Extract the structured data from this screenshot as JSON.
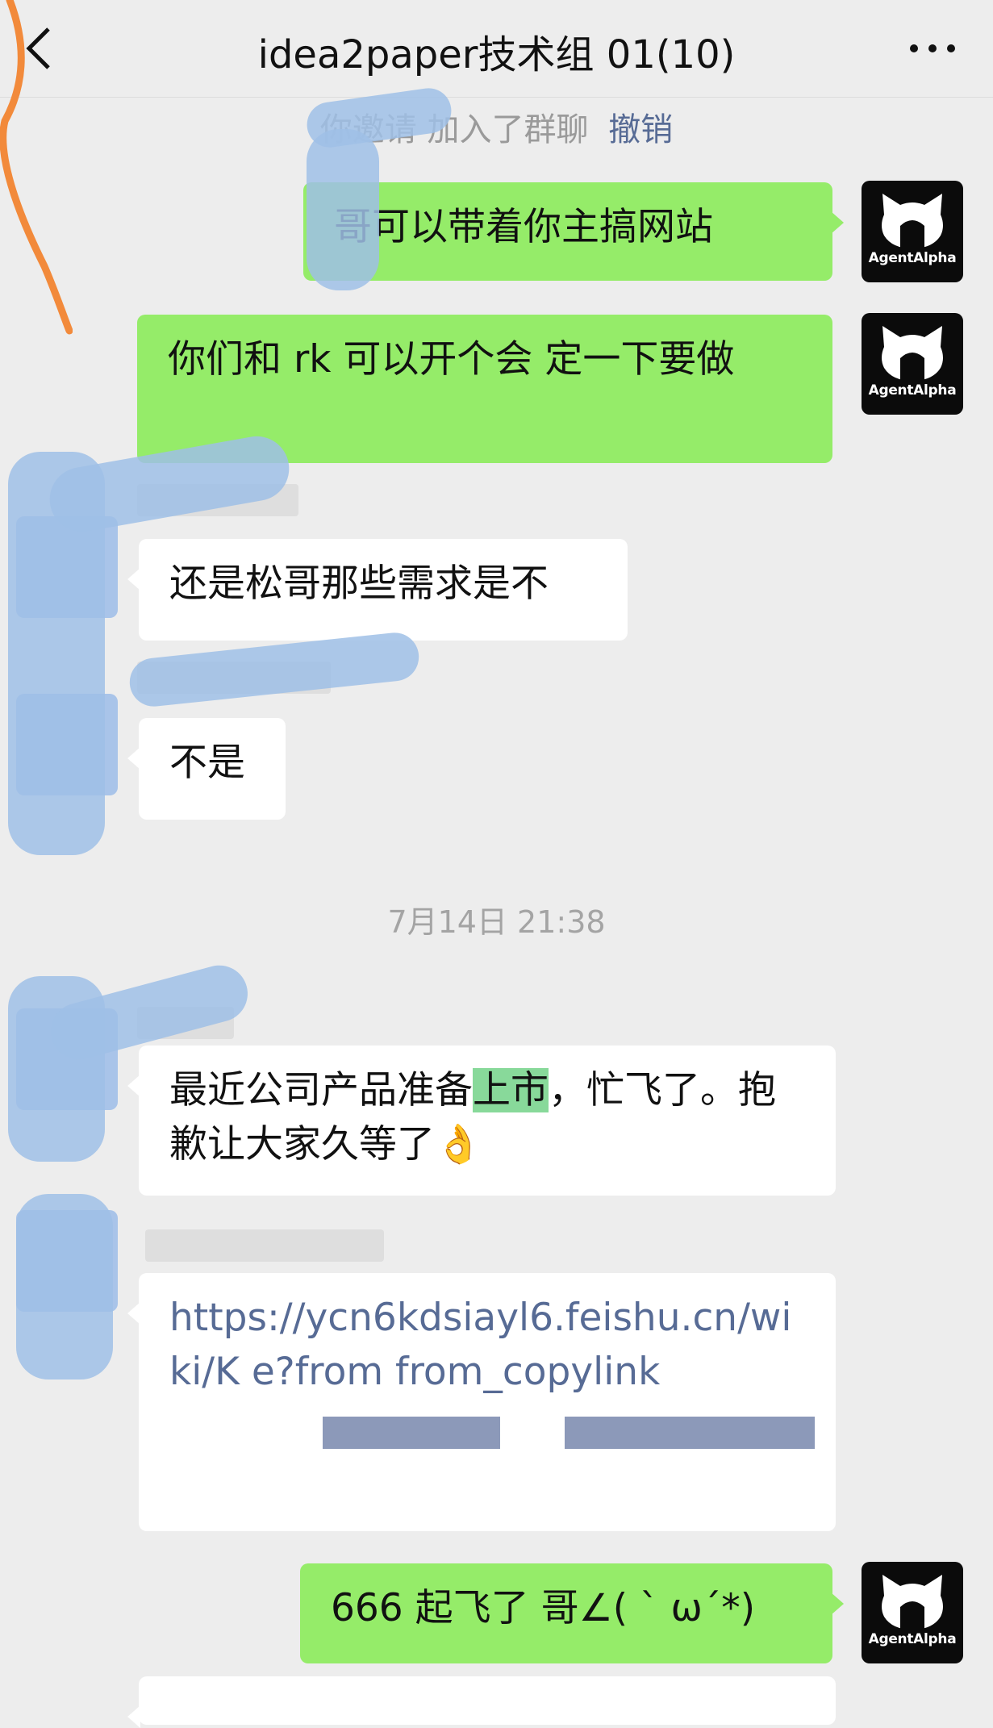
{
  "header": {
    "title": "idea2paper技术组 01(10)",
    "back_icon": "back-chevron-icon",
    "more_icon": "more-dots-icon"
  },
  "system_notice": {
    "text": "你邀请 加入了群聊",
    "undo_label": "撤销"
  },
  "timestamp": "7月14日 21:38",
  "avatar_brand": "AgentAlpha",
  "messages": [
    {
      "side": "right",
      "text": "哥可以带着你主搞网站"
    },
    {
      "side": "right",
      "text": "你们和 rk 可以开个会 定一下要做"
    },
    {
      "side": "left",
      "text": "还是松哥那些需求是不"
    },
    {
      "side": "left",
      "text": "不是"
    },
    {
      "side": "left",
      "text_before": "最近公司产品准备",
      "highlight": "上市",
      "text_after": "，忙飞了。抱歉让大家久等了👌"
    },
    {
      "side": "left",
      "link": "https://ycn6kdsiayl6.feishu.cn/wiki/K e?from from_copylink"
    },
    {
      "side": "right",
      "text": "666 起飞了 哥∠( ` ω´*)"
    }
  ],
  "colors": {
    "background": "#ededed",
    "own_bubble": "#95ec69",
    "other_bubble": "#ffffff",
    "link": "#576b95"
  }
}
